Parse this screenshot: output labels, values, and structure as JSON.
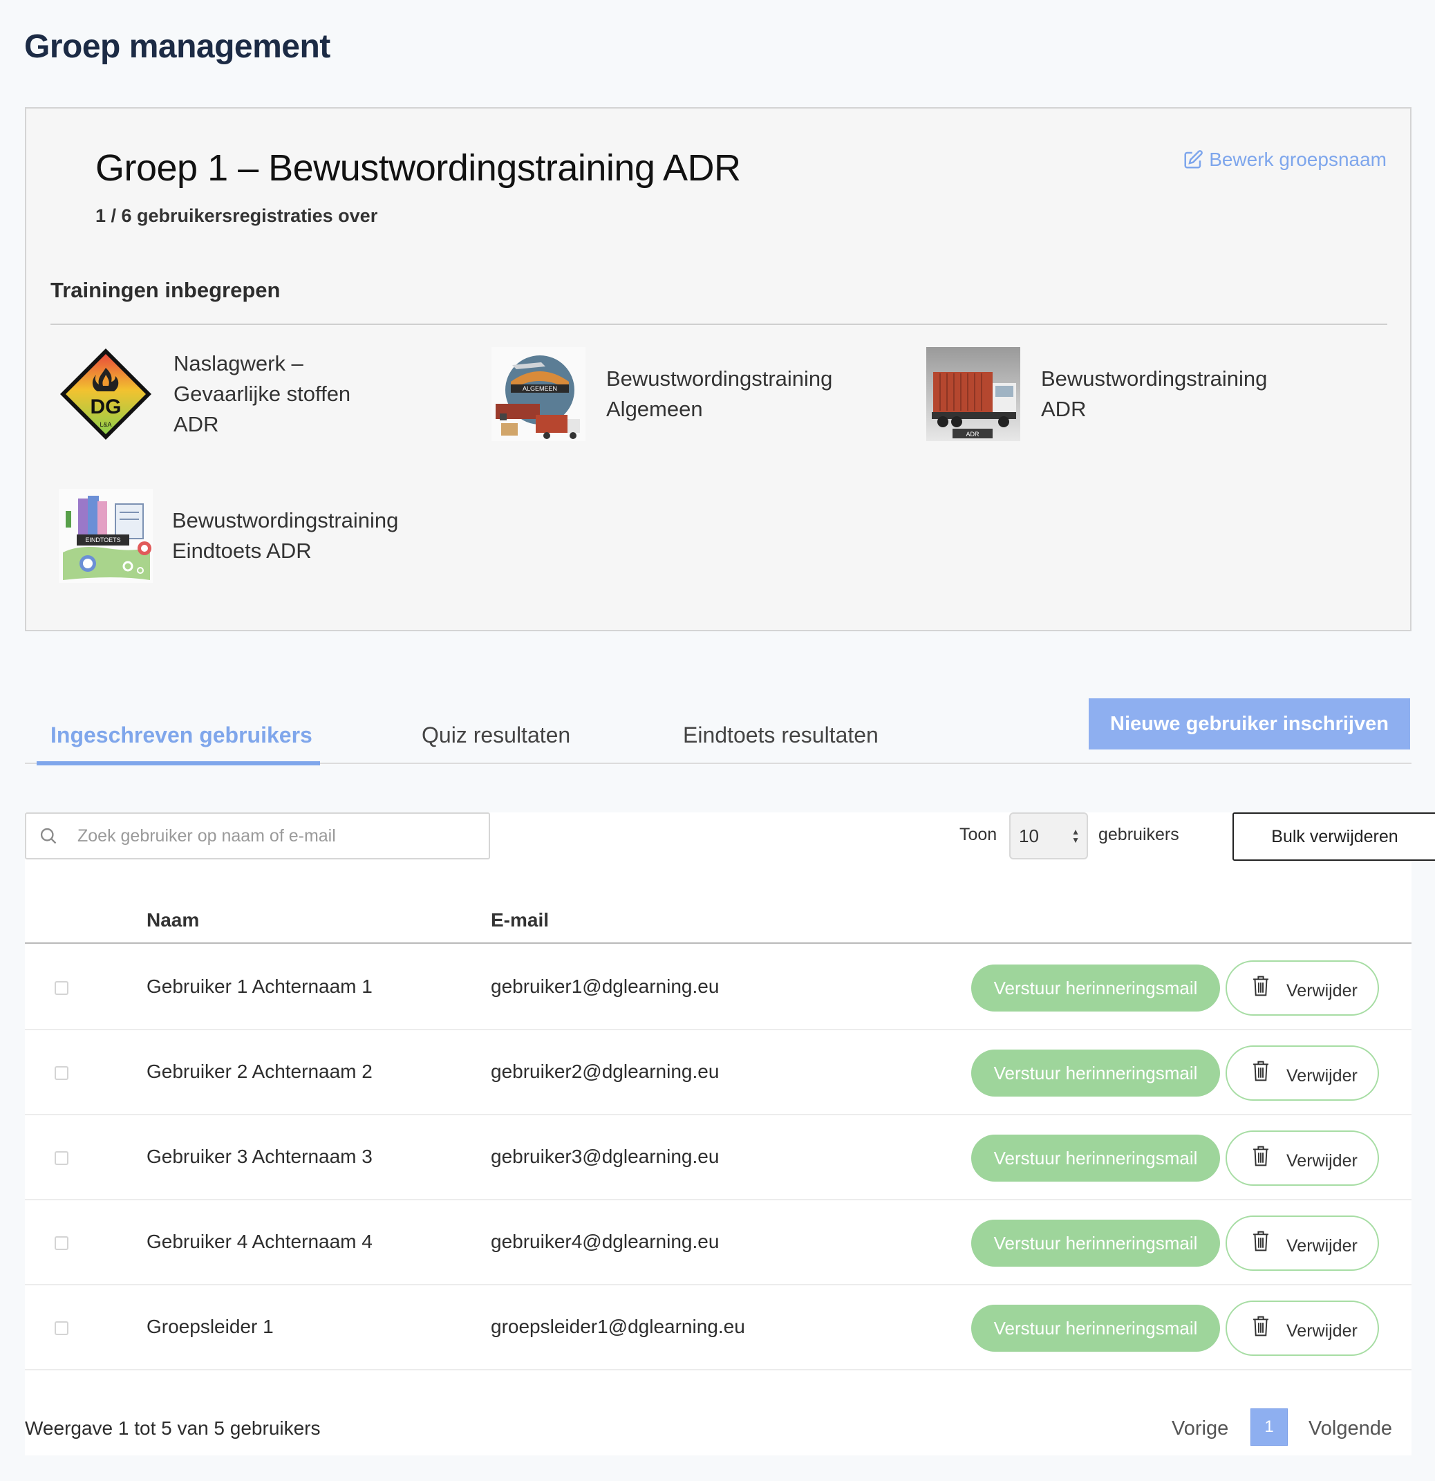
{
  "page": {
    "title": "Groep management"
  },
  "group": {
    "name": "Groep 1 – Bewustwordingstraining ADR",
    "registrations": "1 / 6 gebruikersregistraties over",
    "edit_label": "Bewerk groepsnaam",
    "trainings_heading": "Trainingen inbegrepen",
    "trainings": [
      {
        "line1": "Naslagwerk –",
        "line2": "Gevaarlijke stoffen",
        "line3": "ADR",
        "icon": "hazard-dg-logo"
      },
      {
        "line1": "Bewustwordingstraining",
        "line2": "Algemeen",
        "line3": "",
        "icon": "algemeen-globe-transport",
        "badge": "ALGEMEEN"
      },
      {
        "line1": "Bewustwordingstraining",
        "line2": "ADR",
        "line3": "",
        "icon": "container-truck",
        "badge": "ADR"
      },
      {
        "line1": "Bewustwordingstraining",
        "line2": "Eindtoets ADR",
        "line3": "",
        "icon": "eindtoets-illustration",
        "badge": "EINDTOETS"
      }
    ],
    "hazard_logo": {
      "top": "DG",
      "bottom": "L&A"
    }
  },
  "tabs": [
    {
      "label": "Ingeschreven gebruikers",
      "active": true
    },
    {
      "label": "Quiz resultaten",
      "active": false
    },
    {
      "label": "Eindtoets resultaten",
      "active": false
    }
  ],
  "new_user_label": "Nieuwe gebruiker inschrijven",
  "controls": {
    "search_placeholder": "Zoek gebruiker op naam of e-mail",
    "show_label": "Toon",
    "show_value": "10",
    "users_label": "gebruikers",
    "bulk_delete_label": "Bulk verwijderen"
  },
  "table": {
    "columns": {
      "name": "Naam",
      "email": "E-mail"
    },
    "remind_label": "Verstuur herinneringsmail",
    "delete_label": "Verwijder",
    "rows": [
      {
        "name": "Gebruiker 1 Achternaam 1",
        "email": "gebruiker1@dglearning.eu"
      },
      {
        "name": "Gebruiker 2 Achternaam 2",
        "email": "gebruiker2@dglearning.eu"
      },
      {
        "name": "Gebruiker 3 Achternaam 3",
        "email": "gebruiker3@dglearning.eu"
      },
      {
        "name": "Gebruiker 4 Achternaam 4",
        "email": "gebruiker4@dglearning.eu"
      },
      {
        "name": "Groepsleider 1",
        "email": "groepsleider1@dglearning.eu"
      }
    ]
  },
  "footer": {
    "info": "Weergave 1 tot 5 van 5 gebruikers",
    "prev": "Vorige",
    "page": "1",
    "next": "Volgende"
  },
  "colors": {
    "accent": "#7fa6eb",
    "remind_button": "#9ed59b",
    "heading": "#1c2b45"
  }
}
